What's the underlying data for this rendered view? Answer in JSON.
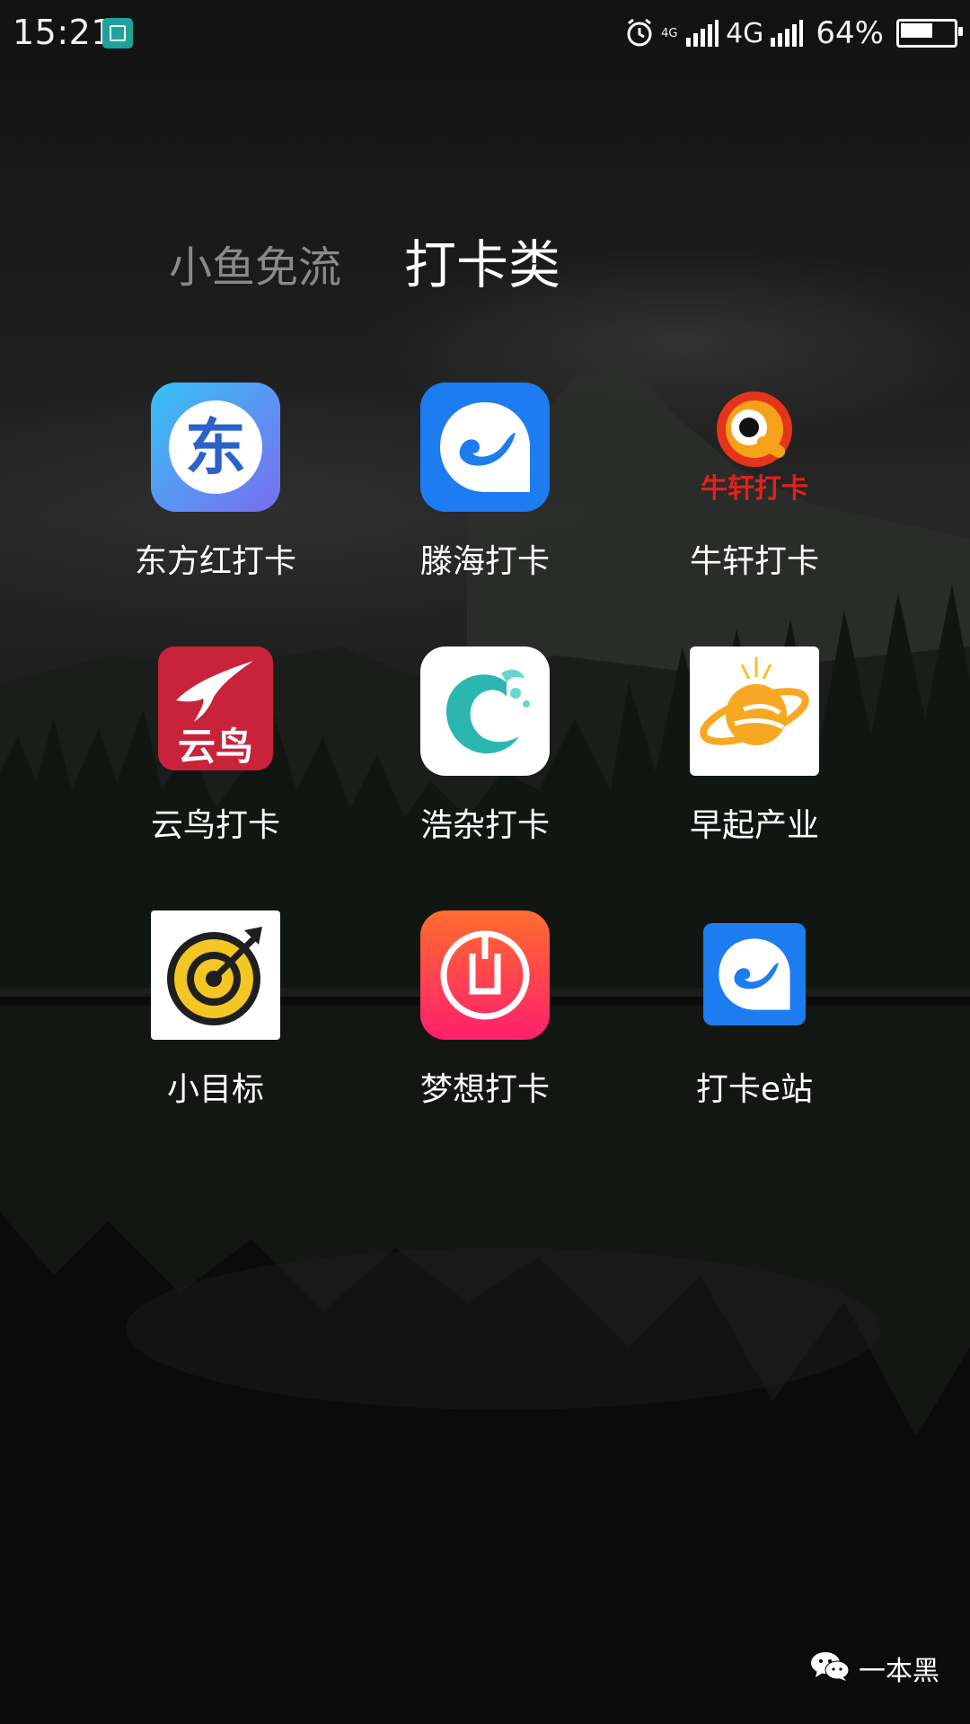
{
  "status_bar": {
    "time": "15:21",
    "network_small": "4G",
    "network": "4G",
    "battery_percent": "64%",
    "battery_level": 0.64
  },
  "folder": {
    "tabs": [
      "小鱼免流",
      "打卡类"
    ],
    "active_tab": "打卡类"
  },
  "apps": [
    {
      "label": "东方红打卡",
      "icon": "dongfanghong-icon"
    },
    {
      "label": "滕海打卡",
      "icon": "tenghai-icon"
    },
    {
      "label": "牛轩打卡",
      "icon": "niuxuan-icon",
      "icon_text": "牛轩打卡"
    },
    {
      "label": "云鸟打卡",
      "icon": "yunniao-icon",
      "icon_text": "云鸟"
    },
    {
      "label": "浩杂打卡",
      "icon": "haoza-icon"
    },
    {
      "label": "早起产业",
      "icon": "zaoqi-icon"
    },
    {
      "label": "小目标",
      "icon": "xiaomubiao-icon"
    },
    {
      "label": "梦想打卡",
      "icon": "mengxiang-icon"
    },
    {
      "label": "打卡e站",
      "icon": "dakaezhan-icon"
    }
  ],
  "icon_text": {
    "dongfanghong": "东"
  },
  "watermark": {
    "text": "一本黑",
    "icon": "wechat-icon"
  }
}
